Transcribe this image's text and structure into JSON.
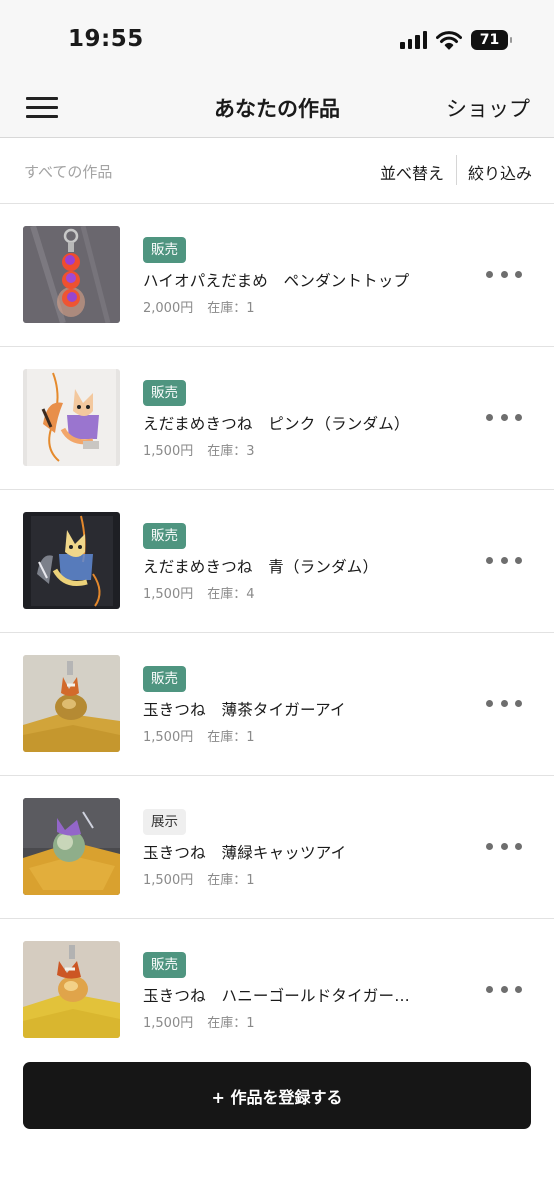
{
  "status_bar": {
    "time": "19:55",
    "battery": "71"
  },
  "nav": {
    "title": "あなたの作品",
    "shop_label": "ショップ"
  },
  "filter": {
    "all_label": "すべての作品",
    "sort_label": "並べ替え",
    "narrow_label": "絞り込み"
  },
  "items": [
    {
      "badge": "販売",
      "badge_kind": "sale",
      "title": "ハイオパえだまめ　ペンダントトップ",
      "price": "2,000円",
      "stock": "在庫：1"
    },
    {
      "badge": "販売",
      "badge_kind": "sale",
      "title": "えだまめきつね　ピンク（ランダム）",
      "price": "1,500円",
      "stock": "在庫：3"
    },
    {
      "badge": "販売",
      "badge_kind": "sale",
      "title": "えだまめきつね　青（ランダム）",
      "price": "1,500円",
      "stock": "在庫：4"
    },
    {
      "badge": "販売",
      "badge_kind": "sale",
      "title": "玉きつね　薄茶タイガーアイ",
      "price": "1,500円",
      "stock": "在庫：1"
    },
    {
      "badge": "展示",
      "badge_kind": "show",
      "title": "玉きつね　薄緑キャッツアイ",
      "price": "1,500円",
      "stock": "在庫：1"
    },
    {
      "badge": "販売",
      "badge_kind": "sale",
      "title": "玉きつね　ハニーゴールドタイガー…",
      "price": "1,500円",
      "stock": "在庫：1"
    }
  ],
  "register_button": "+ 作品を登録する",
  "colors": {
    "sale_badge": "#4f9580",
    "show_badge": "#efefef",
    "button": "#161616",
    "header_bg": "#f7f7f7"
  }
}
